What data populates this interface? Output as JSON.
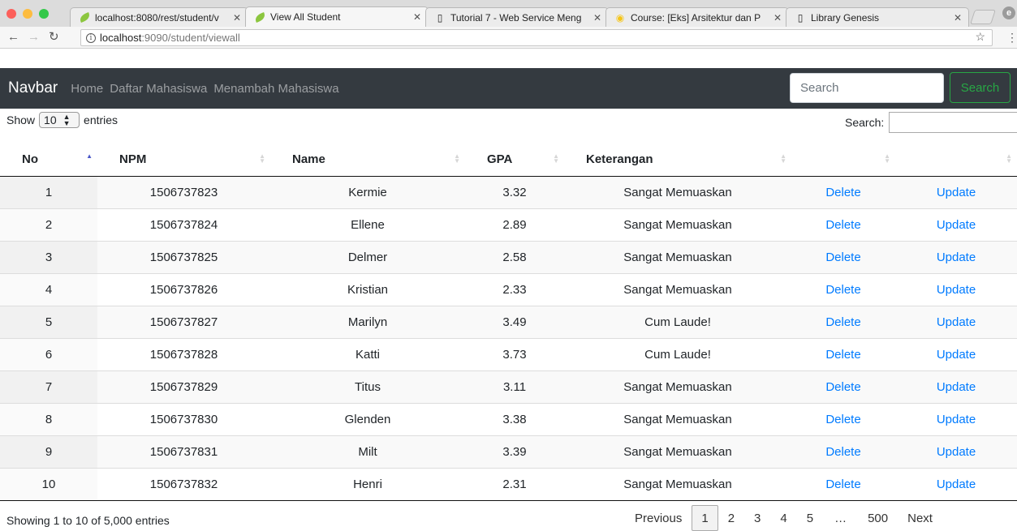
{
  "browser": {
    "tabs": [
      {
        "title": "localhost:8080/rest/student/v",
        "icon": "spring-leaf-icon",
        "active": false
      },
      {
        "title": "View All Student",
        "icon": "spring-leaf-icon",
        "active": true
      },
      {
        "title": "Tutorial 7 - Web Service Meng",
        "icon": "page-icon",
        "active": false
      },
      {
        "title": "Course: [Eks] Arsitektur dan P",
        "icon": "moodle-icon",
        "active": false
      },
      {
        "title": "Library Genesis",
        "icon": "page-icon",
        "active": false
      }
    ],
    "url_host": "localhost",
    "url_path": ":9090/student/viewall"
  },
  "navbar": {
    "brand": "Navbar",
    "links": [
      "Home",
      "Daftar Mahasiswa",
      "Menambah Mahasiswa"
    ],
    "search_placeholder": "Search",
    "search_button": "Search"
  },
  "datatable": {
    "length_prefix": "Show",
    "length_value": "10",
    "length_suffix": "entries",
    "filter_label": "Search:",
    "columns": [
      "No",
      "NPM",
      "Name",
      "GPA",
      "Keterangan",
      "",
      ""
    ],
    "rows": [
      {
        "no": "1",
        "npm": "1506737823",
        "name": "Kermie",
        "gpa": "3.32",
        "ket": "Sangat Memuaskan",
        "delete": "Delete",
        "update": "Update"
      },
      {
        "no": "2",
        "npm": "1506737824",
        "name": "Ellene",
        "gpa": "2.89",
        "ket": "Sangat Memuaskan",
        "delete": "Delete",
        "update": "Update"
      },
      {
        "no": "3",
        "npm": "1506737825",
        "name": "Delmer",
        "gpa": "2.58",
        "ket": "Sangat Memuaskan",
        "delete": "Delete",
        "update": "Update"
      },
      {
        "no": "4",
        "npm": "1506737826",
        "name": "Kristian",
        "gpa": "2.33",
        "ket": "Sangat Memuaskan",
        "delete": "Delete",
        "update": "Update"
      },
      {
        "no": "5",
        "npm": "1506737827",
        "name": "Marilyn",
        "gpa": "3.49",
        "ket": "Cum Laude!",
        "delete": "Delete",
        "update": "Update"
      },
      {
        "no": "6",
        "npm": "1506737828",
        "name": "Katti",
        "gpa": "3.73",
        "ket": "Cum Laude!",
        "delete": "Delete",
        "update": "Update"
      },
      {
        "no": "7",
        "npm": "1506737829",
        "name": "Titus",
        "gpa": "3.11",
        "ket": "Sangat Memuaskan",
        "delete": "Delete",
        "update": "Update"
      },
      {
        "no": "8",
        "npm": "1506737830",
        "name": "Glenden",
        "gpa": "3.38",
        "ket": "Sangat Memuaskan",
        "delete": "Delete",
        "update": "Update"
      },
      {
        "no": "9",
        "npm": "1506737831",
        "name": "Milt",
        "gpa": "3.39",
        "ket": "Sangat Memuaskan",
        "delete": "Delete",
        "update": "Update"
      },
      {
        "no": "10",
        "npm": "1506737832",
        "name": "Henri",
        "gpa": "2.31",
        "ket": "Sangat Memuaskan",
        "delete": "Delete",
        "update": "Update"
      }
    ],
    "info": "Showing 1 to 10 of 5,000 entries",
    "pagination": {
      "previous": "Previous",
      "pages": [
        "1",
        "2",
        "3",
        "4",
        "5",
        "…",
        "500"
      ],
      "current": "1",
      "next": "Next"
    }
  },
  "colors": {
    "navbar_bg": "#343a40",
    "link": "#007bff",
    "success": "#28a745",
    "sort_active": "#4a57c8"
  }
}
